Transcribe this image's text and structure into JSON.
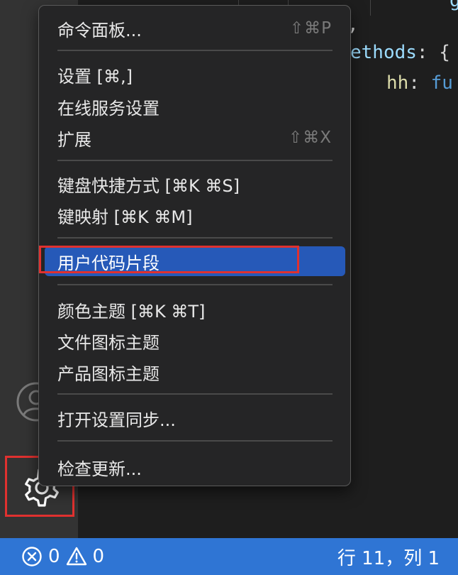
{
  "code": {
    "line1": ",",
    "line2_name": "ethods",
    "line2_rest": ": {",
    "line3_name": "hh",
    "line3_colon": ":",
    "line3_value": "fu",
    "top_glyph": "g"
  },
  "menu": {
    "command_palette": {
      "label": "命令面板...",
      "shortcut": "⇧⌘P"
    },
    "settings": {
      "label": "设置 [⌘,]"
    },
    "online_settings": {
      "label": "在线服务设置"
    },
    "extensions": {
      "label": "扩展",
      "shortcut": "⇧⌘X"
    },
    "keyboard_shortcuts": {
      "label": "键盘快捷方式 [⌘K ⌘S]"
    },
    "keymaps": {
      "label": "键映射 [⌘K ⌘M]"
    },
    "user_snippets": {
      "label": "用户代码片段"
    },
    "color_theme": {
      "label": "颜色主题 [⌘K ⌘T]"
    },
    "file_icon_theme": {
      "label": "文件图标主题"
    },
    "product_icon_theme": {
      "label": "产品图标主题"
    },
    "settings_sync": {
      "label": "打开设置同步..."
    },
    "check_updates": {
      "label": "检查更新..."
    }
  },
  "status_bar": {
    "errors": "0",
    "warnings": "0",
    "cursor_position": "行 11，列 1",
    "error_icon": "error-circle-icon",
    "warning_icon": "warning-triangle-icon"
  },
  "activity_bar": {
    "account_icon": "account-icon",
    "manage_icon": "gear-icon"
  },
  "colors": {
    "highlight": "#2659b8",
    "status_bar": "#2f75d4",
    "annotation_red": "#e0312f",
    "menu_bg": "#252526"
  }
}
